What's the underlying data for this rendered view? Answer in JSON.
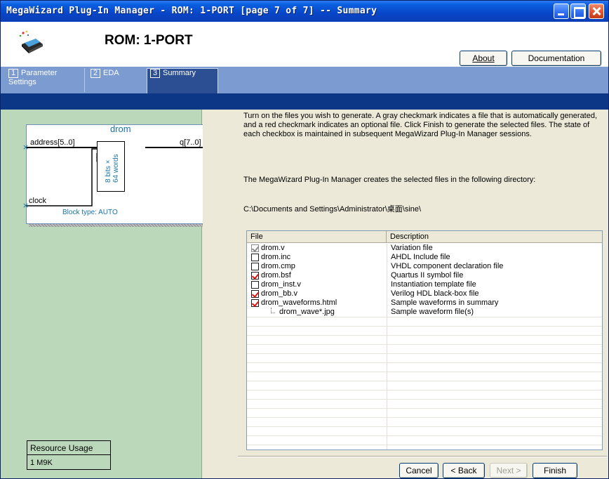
{
  "window": {
    "title": "MegaWizard Plug-In Manager - ROM: 1-PORT [page 7 of 7] -- Summary"
  },
  "header": {
    "title": "ROM: 1-PORT",
    "about_label": "About",
    "docs_label": "Documentation"
  },
  "tabs": [
    {
      "num": "1",
      "label": "Parameter Settings"
    },
    {
      "num": "2",
      "label": "EDA"
    },
    {
      "num": "3",
      "label": "Summary"
    }
  ],
  "block": {
    "name": "drom",
    "port_address": "address[5..0]",
    "port_q": "q[7..0]",
    "port_clock": "clock",
    "mem_bits": "8 bits",
    "mem_words": "64 words",
    "block_type": "Block type: AUTO"
  },
  "resource": {
    "title": "Resource Usage",
    "value": "1 M9K"
  },
  "main": {
    "intro": "Turn on the files you wish to generate. A gray checkmark indicates a file that is automatically generated, and a red checkmark indicates an optional file. Click Finish to generate the selected files. The state of each checkbox is maintained in subsequent MegaWizard Plug-In Manager sessions.",
    "dir_note": "The MegaWizard Plug-In Manager creates the selected files in the following directory:",
    "dir_path": "C:\\Documents and Settings\\Administrator\\桌面\\sine\\"
  },
  "filelist": {
    "col_file": "File",
    "col_desc": "Description",
    "rows": [
      {
        "file": "drom.v",
        "desc": "Variation file",
        "check": "gray"
      },
      {
        "file": "drom.inc",
        "desc": "AHDL Include file",
        "check": "none"
      },
      {
        "file": "drom.cmp",
        "desc": "VHDL component declaration file",
        "check": "none"
      },
      {
        "file": "drom.bsf",
        "desc": "Quartus II symbol file",
        "check": "red"
      },
      {
        "file": "drom_inst.v",
        "desc": "Instantiation template file",
        "check": "none"
      },
      {
        "file": "drom_bb.v",
        "desc": "Verilog HDL black-box file",
        "check": "red"
      },
      {
        "file": "drom_waveforms.html",
        "desc": "Sample waveforms in summary",
        "check": "red"
      },
      {
        "file": "drom_wave*.jpg",
        "desc": "Sample waveform file(s)",
        "check": "child"
      }
    ]
  },
  "buttons": {
    "cancel": "Cancel",
    "back": "< Back",
    "next": "Next >",
    "finish": "Finish"
  },
  "colors": {
    "titlebar": "#0846c8",
    "tabstrip": "#7c9bd0",
    "darkband": "#0b3786",
    "leftpane": "#bbd8bb",
    "check_red": "#dd1111",
    "check_gray": "#8a8a8a",
    "block_text": "#1a73a5"
  }
}
